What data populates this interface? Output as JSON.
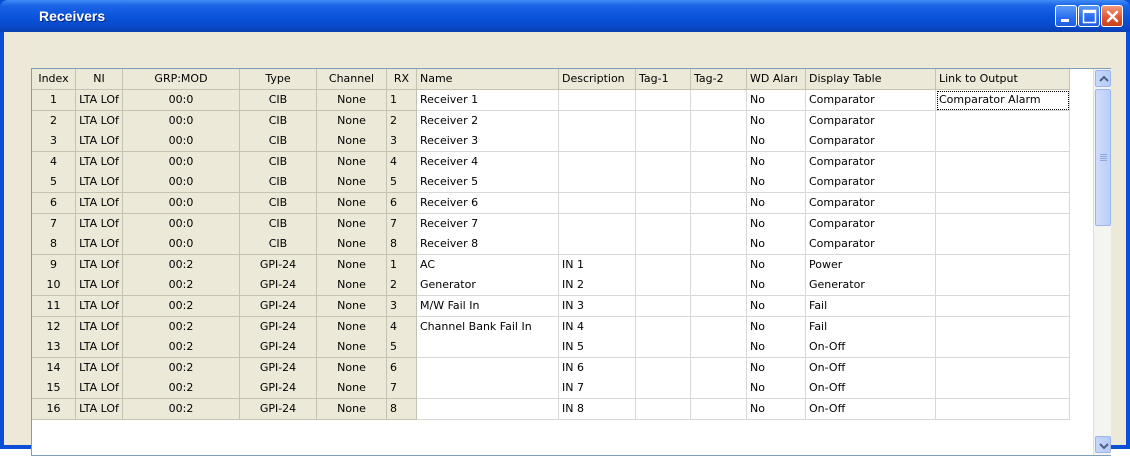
{
  "window": {
    "title": "Receivers",
    "colors": {
      "title_bar": "#0a52d9",
      "client_bg": "#ece9d8",
      "close_button": "#e0532f"
    }
  },
  "table": {
    "headers": [
      "Index",
      "NI",
      "GRP:MOD",
      "Type",
      "Channel",
      "RX",
      "Name",
      "Description",
      "Tag-1",
      "Tag-2",
      "WD Aları",
      "Display Table",
      "Link to Output"
    ],
    "rows": [
      [
        "1",
        "LTA LOf",
        "00:0",
        "CIB",
        "None",
        "1",
        "Receiver 1",
        "",
        "",
        "",
        "No",
        "Comparator",
        "Comparator Alarm"
      ],
      [
        "2",
        "LTA LOf",
        "00:0",
        "CIB",
        "None",
        "2",
        "Receiver 2",
        "",
        "",
        "",
        "No",
        "Comparator",
        ""
      ],
      [
        "3",
        "LTA LOf",
        "00:0",
        "CIB",
        "None",
        "3",
        "Receiver 3",
        "",
        "",
        "",
        "No",
        "Comparator",
        ""
      ],
      [
        "4",
        "LTA LOf",
        "00:0",
        "CIB",
        "None",
        "4",
        "Receiver 4",
        "",
        "",
        "",
        "No",
        "Comparator",
        ""
      ],
      [
        "5",
        "LTA LOf",
        "00:0",
        "CIB",
        "None",
        "5",
        "Receiver 5",
        "",
        "",
        "",
        "No",
        "Comparator",
        ""
      ],
      [
        "6",
        "LTA LOf",
        "00:0",
        "CIB",
        "None",
        "6",
        "Receiver 6",
        "",
        "",
        "",
        "No",
        "Comparator",
        ""
      ],
      [
        "7",
        "LTA LOf",
        "00:0",
        "CIB",
        "None",
        "7",
        "Receiver 7",
        "",
        "",
        "",
        "No",
        "Comparator",
        ""
      ],
      [
        "8",
        "LTA LOf",
        "00:0",
        "CIB",
        "None",
        "8",
        "Receiver 8",
        "",
        "",
        "",
        "No",
        "Comparator",
        ""
      ],
      [
        "9",
        "LTA LOf",
        "00:2",
        "GPI-24",
        "None",
        "1",
        "AC",
        "IN 1",
        "",
        "",
        "No",
        "Power",
        ""
      ],
      [
        "10",
        "LTA LOf",
        "00:2",
        "GPI-24",
        "None",
        "2",
        "Generator",
        "IN 2",
        "",
        "",
        "No",
        "Generator",
        ""
      ],
      [
        "11",
        "LTA LOf",
        "00:2",
        "GPI-24",
        "None",
        "3",
        "M/W Fail In",
        "IN 3",
        "",
        "",
        "No",
        "Fail",
        ""
      ],
      [
        "12",
        "LTA LOf",
        "00:2",
        "GPI-24",
        "None",
        "4",
        "Channel Bank Fail In",
        "IN 4",
        "",
        "",
        "No",
        "Fail",
        ""
      ],
      [
        "13",
        "LTA LOf",
        "00:2",
        "GPI-24",
        "None",
        "5",
        "",
        "IN 5",
        "",
        "",
        "No",
        "On-Off",
        ""
      ],
      [
        "14",
        "LTA LOf",
        "00:2",
        "GPI-24",
        "None",
        "6",
        "",
        "IN 6",
        "",
        "",
        "No",
        "On-Off",
        ""
      ],
      [
        "15",
        "LTA LOf",
        "00:2",
        "GPI-24",
        "None",
        "7",
        "",
        "IN 7",
        "",
        "",
        "No",
        "On-Off",
        ""
      ],
      [
        "16",
        "LTA LOf",
        "00:2",
        "GPI-24",
        "None",
        "8",
        "",
        "IN 8",
        "",
        "",
        "No",
        "On-Off",
        ""
      ]
    ],
    "selected_cell": {
      "row": 0,
      "column": 12
    }
  }
}
